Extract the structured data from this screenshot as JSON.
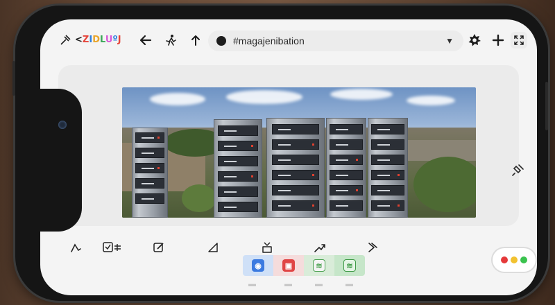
{
  "app": {
    "logo_text": [
      "<",
      "Z",
      "I",
      "D",
      "L",
      "U",
      "º",
      "J"
    ],
    "url_text": "#magajenibation"
  },
  "toolbar": {
    "left_icons": [
      "pin-icon",
      "back-icon",
      "walk-icon",
      "upload-icon"
    ],
    "right_icons": [
      "settings-icon",
      "add-icon",
      "fullscreen-icon"
    ]
  },
  "bottom_tools": [
    "draw-icon",
    "checklist-icon",
    "edit-icon",
    "triangle-icon",
    "download-icon",
    "forward-icon",
    "chevron-right-icon"
  ],
  "chips": [
    {
      "icon": "person-icon",
      "bg": "#cfe0f7",
      "fg": "#3b7ae0"
    },
    {
      "icon": "camera-icon",
      "bg": "#f5d9d9",
      "fg": "#e04646"
    },
    {
      "icon": "sheet-icon",
      "bg": "#d6ead6",
      "fg": "#4ea354"
    },
    {
      "icon": "sheet-alt-icon",
      "bg": "#c6e6c9",
      "fg": "#3f9a47"
    }
  ],
  "window_dots": {
    "red": "#e5393a",
    "yellow": "#f2c230",
    "green": "#3ac34e"
  },
  "colors": {
    "accent": "#2d7fe0",
    "toolbar_bg": "#f4f4f4",
    "search_bg": "#ececec"
  }
}
